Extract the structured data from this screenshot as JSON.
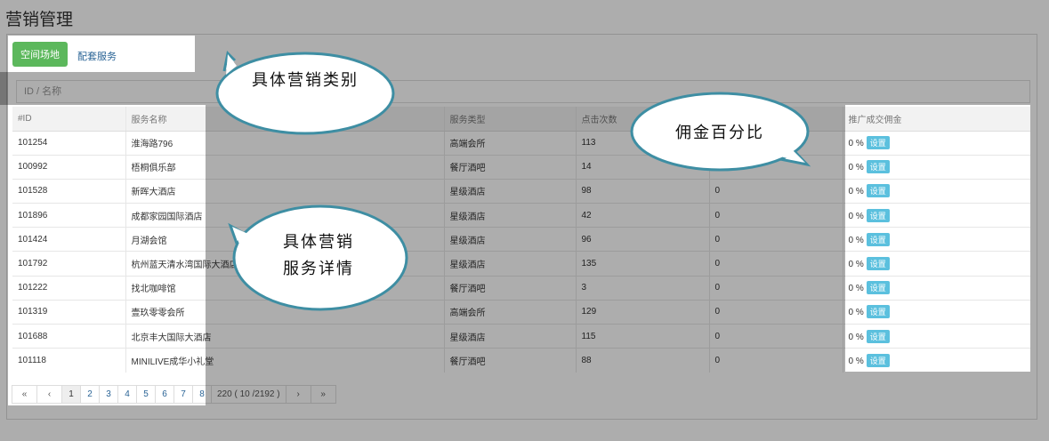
{
  "page": {
    "title": "营销管理"
  },
  "toolbar": {
    "primary_button": "空间场地",
    "secondary_tab": "配套服务"
  },
  "search": {
    "placeholder": "ID / 名称"
  },
  "table": {
    "headers": {
      "id": "#ID",
      "name": "服务名称",
      "type": "服务类型",
      "clicks": "点击次数",
      "rate": "",
      "commission": "推广成交佣金"
    },
    "set_label": "设置",
    "rows": [
      {
        "id": "101254",
        "name": "淮海路796",
        "type": "高端会所",
        "clicks": "113",
        "rate": "",
        "commission": "0 %"
      },
      {
        "id": "100992",
        "name": "梧桐俱乐部",
        "type": "餐厅酒吧",
        "clicks": "14",
        "rate": "",
        "commission": "0 %"
      },
      {
        "id": "101528",
        "name": "新晖大酒店",
        "type": "星级酒店",
        "clicks": "98",
        "rate": "0",
        "commission": "0 %"
      },
      {
        "id": "101896",
        "name": "成都家园国际酒店",
        "type": "星级酒店",
        "clicks": "42",
        "rate": "0",
        "commission": "0 %"
      },
      {
        "id": "101424",
        "name": "月湖会馆",
        "type": "星级酒店",
        "clicks": "96",
        "rate": "0",
        "commission": "0 %"
      },
      {
        "id": "101792",
        "name": "杭州蓝天清水湾国际大酒店",
        "type": "星级酒店",
        "clicks": "135",
        "rate": "0",
        "commission": "0 %"
      },
      {
        "id": "101222",
        "name": "找北咖啡馆",
        "type": "餐厅酒吧",
        "clicks": "3",
        "rate": "0",
        "commission": "0 %"
      },
      {
        "id": "101319",
        "name": "壹玖零零会所",
        "type": "高端会所",
        "clicks": "129",
        "rate": "0",
        "commission": "0 %"
      },
      {
        "id": "101688",
        "name": "北京丰大国际大酒店",
        "type": "星级酒店",
        "clicks": "115",
        "rate": "0",
        "commission": "0 %"
      },
      {
        "id": "101118",
        "name": "MINILIVE成华小礼堂",
        "type": "餐厅酒吧",
        "clicks": "88",
        "rate": "0",
        "commission": "0 %"
      }
    ]
  },
  "pagination": {
    "first": "«",
    "prev": "‹",
    "pages": [
      "1",
      "2",
      "3",
      "4",
      "5",
      "6",
      "7",
      "8"
    ],
    "info": "220 ( 10 /2192 )",
    "next": "›",
    "last": "»"
  },
  "callouts": {
    "category": "具体营销类别",
    "commission": "佣金百分比",
    "service_line1": "具体营销",
    "service_line2": "服务详情"
  }
}
